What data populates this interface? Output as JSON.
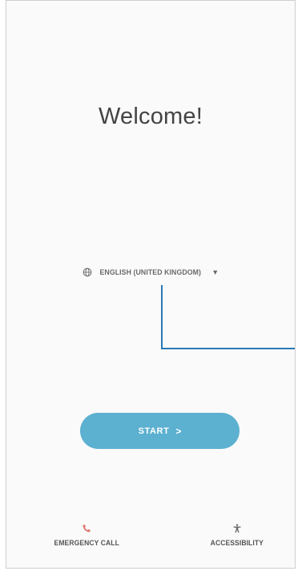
{
  "welcome": {
    "title": "Welcome!"
  },
  "language": {
    "icon": "globe-icon",
    "label": "ENGLISH (UNITED KINGDOM)",
    "dropdown_icon": "caret-down-icon"
  },
  "start": {
    "label": "START",
    "chevron": ">"
  },
  "bottom": {
    "emergency": {
      "icon": "phone-icon",
      "label": "EMERGENCY CALL"
    },
    "accessibility": {
      "icon": "accessibility-icon",
      "label": "ACCESSIBILITY"
    }
  },
  "colors": {
    "accent": "#5cb0d0",
    "emergency_icon": "#e0766f",
    "callout": "#2a78b4",
    "text": "#444444"
  }
}
